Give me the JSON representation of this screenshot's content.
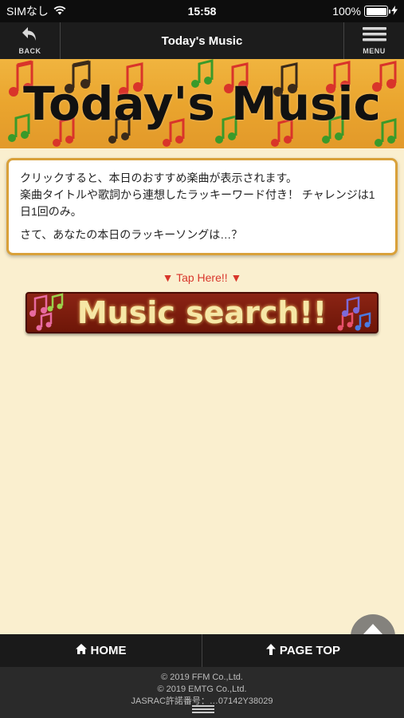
{
  "status_bar": {
    "carrier": "SIMなし",
    "time": "15:58",
    "battery": "100%"
  },
  "nav": {
    "back_label": "BACK",
    "title": "Today's Music",
    "menu_label": "MENU"
  },
  "banner": {
    "title": "Today's Music"
  },
  "info": {
    "line1": "クリックすると、本日のおすすめ楽曲が表示されます。",
    "line2": "楽曲タイトルや歌詞から連想したラッキーワード付き！ チャレンジは1日1回のみ。",
    "line3": "さて、あなたの本日のラッキーソングは…？"
  },
  "tap_here": "▼ Tap Here!! ▼",
  "search_button": {
    "label": "Music search!!"
  },
  "footer": {
    "home_label": "HOME",
    "page_top_label": "PAGE TOP",
    "copy1": "© 2019 FFM Co.,Ltd.",
    "copy2": "© 2019 EMTG Co.,Ltd.",
    "copy3": "JASRAC許諾番号：…07142Y38029"
  },
  "colors": {
    "accent": "#d8362b",
    "banner": "#eaa52e",
    "background": "#faefcf"
  }
}
